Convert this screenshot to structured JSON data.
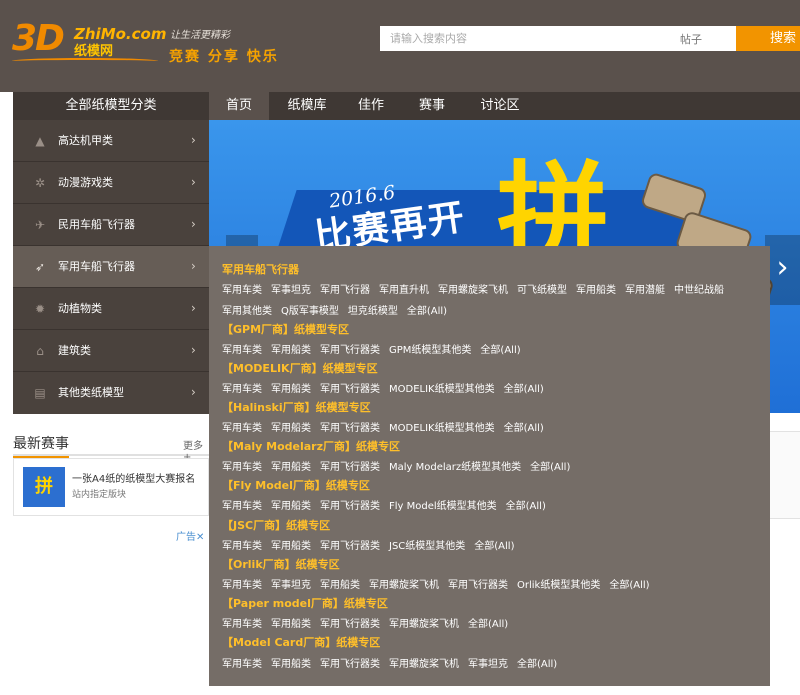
{
  "header": {
    "logo_main": "3D",
    "logo_brand": "ZhiMo.com",
    "logo_cn": "纸模网",
    "tagline_small": "让生活更精彩",
    "tagline_big": "竞赛 分享 快乐",
    "search_placeholder": "请输入搜索内容",
    "search_type": "帖子",
    "search_button": "搜索"
  },
  "nav": {
    "all_categories": "全部纸模型分类",
    "items": [
      "首页",
      "纸模库",
      "佳作",
      "赛事",
      "讨论区"
    ]
  },
  "sidebar": {
    "items": [
      {
        "label": "高达机甲类",
        "icon": "mecha-icon"
      },
      {
        "label": "动漫游戏类",
        "icon": "gear-icon"
      },
      {
        "label": "民用车船飞行器",
        "icon": "plane-icon"
      },
      {
        "label": "军用车船飞行器",
        "icon": "rocket-icon"
      },
      {
        "label": "动植物类",
        "icon": "bug-icon"
      },
      {
        "label": "建筑类",
        "icon": "house-icon"
      },
      {
        "label": "其他类纸模型",
        "icon": "box-icon"
      }
    ],
    "chevron": "›"
  },
  "banner": {
    "date": "2016.6",
    "title": "比赛再开",
    "big": "拼",
    "next_arrow": "›"
  },
  "news": {
    "title": "最新赛事",
    "more": "更多+",
    "item_title": "一张A4纸的纸模型大赛报名",
    "item_sub": "站内指定版块",
    "thumb_text": "拼"
  },
  "ad_label": "广告✕",
  "dropdown": {
    "sections": [
      {
        "title": "军用车船飞行器",
        "rows": [
          [
            "军用车类",
            "军事坦克",
            "军用飞行器",
            "军用直升机",
            "军用螺旋桨飞机",
            "可飞纸模型",
            "军用船类",
            "军用潜艇",
            "中世纪战船"
          ],
          [
            "军用其他类",
            "Q版军事模型",
            "坦克纸模型",
            "全部(All)"
          ]
        ]
      },
      {
        "title": "【GPM厂商】纸模型专区",
        "rows": [
          [
            "军用车类",
            "军用船类",
            "军用飞行器类",
            "GPM纸模型其他类",
            "全部(All)"
          ]
        ]
      },
      {
        "title": "【MODELIK厂商】纸模型专区",
        "rows": [
          [
            "军用车类",
            "军用船类",
            "军用飞行器类",
            "MODELIK纸模型其他类",
            "全部(All)"
          ]
        ]
      },
      {
        "title": "【Halinski厂商】纸模型专区",
        "rows": [
          [
            "军用车类",
            "军用船类",
            "军用飞行器类",
            "MODELIK纸模型其他类",
            "全部(All)"
          ]
        ]
      },
      {
        "title": "【Maly Modelarz厂商】纸模专区",
        "rows": [
          [
            "军用车类",
            "军用船类",
            "军用飞行器类",
            "Maly Modelarz纸模型其他类",
            "全部(All)"
          ]
        ]
      },
      {
        "title": "【Fly Model厂商】纸模专区",
        "rows": [
          [
            "军用车类",
            "军用船类",
            "军用飞行器类",
            "Fly Model纸模型其他类",
            "全部(All)"
          ]
        ]
      },
      {
        "title": "【JSC厂商】纸模专区",
        "rows": [
          [
            "军用车类",
            "军用船类",
            "军用飞行器类",
            "JSC纸模型其他类",
            "全部(All)"
          ]
        ]
      },
      {
        "title": "【Orlik厂商】纸模专区",
        "rows": [
          [
            "军用车类",
            "军事坦克",
            "军用船类",
            "军用螺旋桨飞机",
            "军用飞行器类",
            "Orlik纸模型其他类",
            "全部(All)"
          ]
        ]
      },
      {
        "title": "【Paper model厂商】纸模专区",
        "rows": [
          [
            "军用车类",
            "军用船类",
            "军用飞行器类",
            "军用螺旋桨飞机",
            "全部(All)"
          ]
        ]
      },
      {
        "title": "【Model Card厂商】纸模专区",
        "rows": [
          [
            "军用车类",
            "军用船类",
            "军用飞行器类",
            "军用螺旋桨飞机",
            "军事坦克",
            "全部(All)"
          ]
        ]
      }
    ]
  }
}
